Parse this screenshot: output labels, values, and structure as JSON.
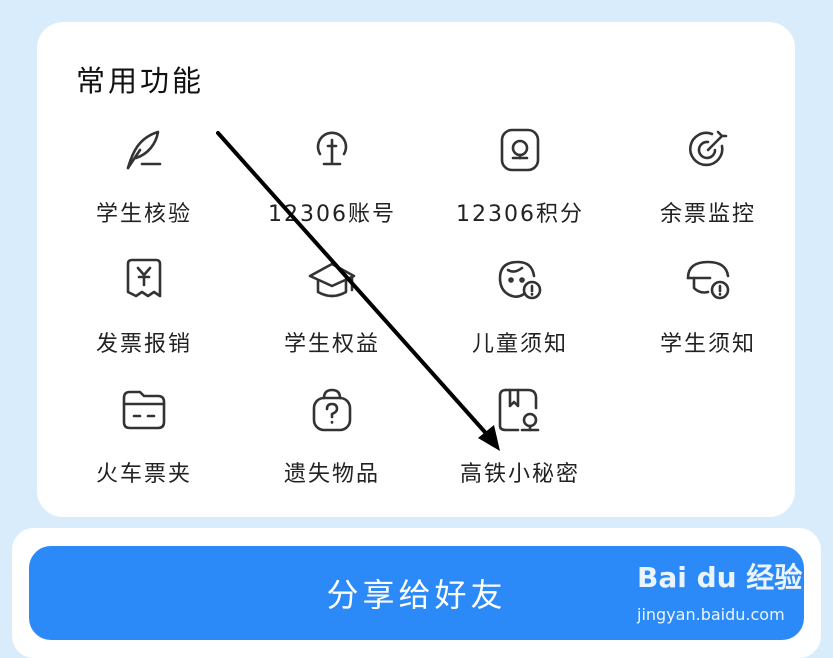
{
  "section": {
    "title": "常用功能",
    "items": [
      {
        "label": "学生核验",
        "icon": "feather-pen-icon"
      },
      {
        "label": "12306账号",
        "icon": "account-lamp-icon"
      },
      {
        "label": "12306积分",
        "icon": "points-icon"
      },
      {
        "label": "余票监控",
        "icon": "target-icon"
      },
      {
        "label": "发票报销",
        "icon": "invoice-yen-icon"
      },
      {
        "label": "学生权益",
        "icon": "graduation-cap-icon"
      },
      {
        "label": "儿童须知",
        "icon": "child-face-info-icon"
      },
      {
        "label": "学生须知",
        "icon": "student-cap-info-icon"
      },
      {
        "label": "火车票夹",
        "icon": "ticket-folder-icon"
      },
      {
        "label": "遗失物品",
        "icon": "lost-bag-question-icon"
      },
      {
        "label": "高铁小秘密",
        "icon": "train-secret-book-icon"
      }
    ]
  },
  "share": {
    "label": "分享给好友"
  },
  "watermark": {
    "brand": "Bai du 经验",
    "url": "jingyan.baidu.com"
  },
  "colors": {
    "background": "#d9ecfb",
    "card": "#ffffff",
    "accent": "#2b8af7",
    "icon_stroke": "#333333"
  }
}
